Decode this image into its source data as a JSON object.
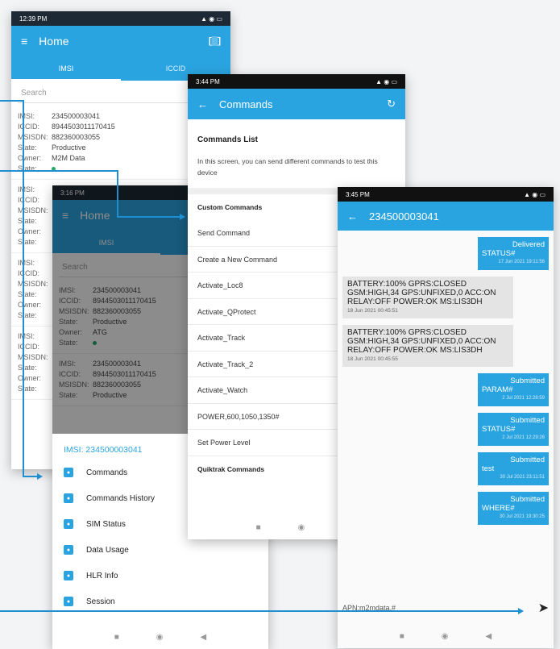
{
  "colors": {
    "primary": "#2aa4e0",
    "status_dark": "#1d2a35",
    "connector": "#1e8fd0",
    "state_ok": "#23a866"
  },
  "screen1": {
    "status": {
      "time": "12:39 PM",
      "icons": "signal wifi battery"
    },
    "appbar": {
      "title": "Home",
      "menu_icon": "menu-icon",
      "scan_icon": "scan-icon"
    },
    "tabs": [
      "IMSI",
      "ICCID"
    ],
    "search_placeholder": "Search",
    "card": {
      "imsi_label": "IMSI:",
      "imsi": "234500003041",
      "iccid_label": "ICCID:",
      "iccid": "8944503011170415",
      "msisdn_label": "MSISDN:",
      "msisdn": "882360003055",
      "state_label": "State:",
      "state": "Productive",
      "owner_label": "Owner:",
      "owner": "M2M Data",
      "state2_label": "State:"
    },
    "stub_labels": [
      "IMSI:",
      "ICCID:",
      "MSISDN:",
      "State:",
      "Owner:",
      "State:"
    ]
  },
  "screen2": {
    "status": {
      "time": "3:16 PM"
    },
    "appbar": {
      "title": "Home"
    },
    "tab": "IMSI",
    "search_placeholder": "Search",
    "cards": [
      {
        "imsi": "234500003041",
        "iccid": "8944503011170415",
        "msisdn": "882360003055",
        "state": "Productive",
        "owner": "ATG"
      },
      {
        "imsi": "234500003041",
        "iccid": "8944503011170415",
        "msisdn": "882360003055",
        "state": "Productive"
      }
    ],
    "labels": {
      "imsi": "IMSI:",
      "iccid": "ICCID:",
      "msisdn": "MSISDN:",
      "state": "State:",
      "owner": "Owner:"
    },
    "sheet": {
      "header": "IMSI: 234500003041",
      "items": [
        {
          "label": "Commands",
          "icon": "commands-icon",
          "color": "#2aa4e0"
        },
        {
          "label": "Commands History",
          "icon": "history-icon",
          "color": "#2aa4e0"
        },
        {
          "label": "SIM Status",
          "icon": "info-icon",
          "color": "#2aa4e0"
        },
        {
          "label": "Data Usage",
          "icon": "chart-icon",
          "color": "#2aa4e0"
        },
        {
          "label": "HLR Info",
          "icon": "database-icon",
          "color": "#2aa4e0"
        },
        {
          "label": "Session",
          "icon": "session-icon",
          "color": "#2aa4e0"
        }
      ]
    }
  },
  "screen3": {
    "status": {
      "time": "3:44 PM"
    },
    "appbar": {
      "title": "Commands"
    },
    "heading": "Commands List",
    "description": "In this screen, you can send different commands to test this device",
    "custom_section": "Custom Commands",
    "items": [
      "Send Command",
      "Create a New Command",
      "Activate_Loc8",
      "Activate_QProtect",
      "Activate_Track",
      "Activate_Track_2",
      "Activate_Watch",
      "POWER,600,1050,1350#",
      "Set Power Level"
    ],
    "quiktrak_section": "Quiktrak Commands"
  },
  "screen4": {
    "status": {
      "time": "3:45 PM"
    },
    "appbar": {
      "title": "234500003041"
    },
    "messages": [
      {
        "dir": "out",
        "status": "Delivered",
        "text": "STATUS#",
        "ts": "17 Jun 2021 19:11:56"
      },
      {
        "dir": "in",
        "text": "BATTERY:100% GPRS:CLOSED GSM:HIGH,34 GPS:UNFIXED,0 ACC:ON RELAY:OFF POWER:OK MS:LIS3DH",
        "ts": "18 Jun 2021 00:45:51"
      },
      {
        "dir": "in",
        "text": "BATTERY:100% GPRS:CLOSED GSM:HIGH,34 GPS:UNFIXED,0 ACC:ON RELAY:OFF POWER:OK MS:LIS3DH",
        "ts": "18 Jun 2021 00:45:55"
      },
      {
        "dir": "out",
        "status": "Submitted",
        "text": "PARAM#",
        "ts": "2 Jul 2021 12:28:59"
      },
      {
        "dir": "out",
        "status": "Submitted",
        "text": "STATUS#",
        "ts": "2 Jul 2021 12:29:26"
      },
      {
        "dir": "out",
        "status": "Submitted",
        "text": "test",
        "ts": "30 Jul 2021 23:11:51"
      },
      {
        "dir": "out",
        "status": "Submitted",
        "text": "WHERE#",
        "ts": "30 Jul 2021 19:30:25"
      }
    ],
    "input_value": "APN:m2mdata,#",
    "send_icon": "send-icon"
  }
}
